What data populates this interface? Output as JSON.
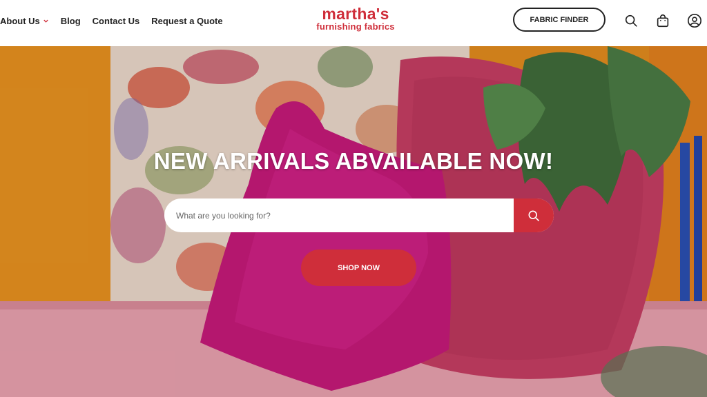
{
  "brand": {
    "name": "martha's",
    "tagline": "furnishing fabrics",
    "color": "#cf2e3a"
  },
  "nav": {
    "items": [
      {
        "label": "About Us",
        "has_dropdown": true
      },
      {
        "label": "Blog"
      },
      {
        "label": "Contact Us"
      },
      {
        "label": "Request a Quote"
      }
    ]
  },
  "header": {
    "fabric_finder_label": "FABRIC FINDER",
    "icons": [
      "search-icon",
      "shopping-bag-icon",
      "account-icon"
    ]
  },
  "hero": {
    "headline": "NEW ARRIVALS ABVAILABLE NOW!",
    "search_placeholder": "What are you looking for?",
    "shop_label": "SHOP NOW"
  }
}
